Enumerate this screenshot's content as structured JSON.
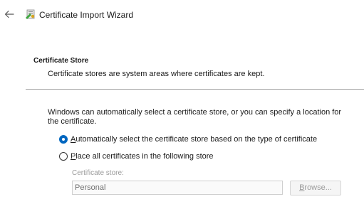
{
  "window": {
    "title": "Certificate Import Wizard",
    "back_icon": "back-arrow-icon",
    "wizard_icon": "certificate-wizard-icon"
  },
  "section": {
    "title": "Certificate Store",
    "description": "Certificate stores are system areas where certificates are kept."
  },
  "intro_text": "Windows can automatically select a certificate store, or you can specify a location for the certificate.",
  "options": {
    "auto": {
      "label_prefix": "",
      "mnemonic": "A",
      "label_rest": "utomatically select the certificate store based on the type of certificate",
      "checked": true
    },
    "manual": {
      "label_prefix": "",
      "mnemonic": "P",
      "label_rest": "lace all certificates in the following store",
      "checked": false
    }
  },
  "store": {
    "label": "Certificate store:",
    "value": "Personal",
    "browse_mnemonic": "B",
    "browse_rest": "rowse..."
  },
  "colors": {
    "accent": "#0067c0",
    "disabled_text": "#9a9a9a",
    "divider": "#a0a0a0"
  }
}
